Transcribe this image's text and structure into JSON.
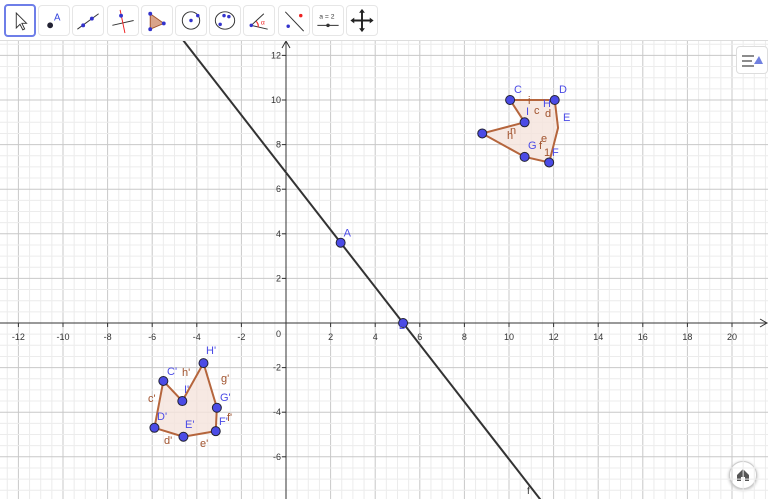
{
  "toolbar": {
    "tools": [
      "Move",
      "Point",
      "Line",
      "Perpendicular Line",
      "Polygon",
      "Circle with Center",
      "Circle through 3 Points",
      "Angle",
      "Reflect about Line",
      "Slider",
      "Move Graphics View"
    ],
    "slider_label": "a = 2",
    "point_label": "A",
    "angle_label": "α"
  },
  "right": {
    "undo": "undo-icon",
    "redo": "redo-icon",
    "search": "search-icon",
    "menu": "menu-icon"
  },
  "axes": {
    "x_ticks": [
      -12,
      -10,
      -8,
      -6,
      -4,
      -2,
      2,
      4,
      6,
      8,
      10,
      12,
      14,
      16,
      18,
      20
    ],
    "y_ticks": [
      12,
      10,
      8,
      6,
      4,
      2,
      -2,
      -4,
      -6
    ],
    "origin_label": "0",
    "xrange": [
      -12.8,
      21.6
    ],
    "yrange": [
      -7.8,
      12.3
    ]
  },
  "line": {
    "name": "f",
    "points": [
      [
        2.45,
        3.6
      ],
      [
        5.25,
        0
      ]
    ]
  },
  "free_points": [
    {
      "name": "A",
      "x": 2.45,
      "y": 3.6
    },
    {
      "name": "B",
      "x": 5.25,
      "y": 0
    }
  ],
  "polygon": {
    "vertices": [
      [
        10.05,
        10
      ],
      [
        12.05,
        10
      ],
      [
        12.2,
        8.75
      ],
      [
        11.8,
        7.2
      ],
      [
        10.7,
        7.45
      ],
      [
        8.8,
        8.5
      ],
      [
        10.7,
        9.0
      ]
    ],
    "labels": [
      "C",
      "D",
      "H",
      "E",
      "F",
      "G",
      "I"
    ],
    "edge_labels": [
      "i",
      "c",
      "d",
      "e",
      "f",
      "1",
      "h",
      "n"
    ]
  },
  "image": {
    "vertices": [
      [
        -5.5,
        -2.6
      ],
      [
        -4.65,
        -3.5
      ],
      [
        -3.7,
        -1.8
      ],
      [
        -3.1,
        -3.8
      ],
      [
        -3.15,
        -4.85
      ],
      [
        -4.6,
        -5.1
      ],
      [
        -5.9,
        -4.7
      ]
    ],
    "labels": [
      "C'",
      "I'",
      "H'",
      "G'",
      "F'",
      "E'",
      "D'"
    ],
    "edge_labels": [
      "h'",
      "g'",
      "c'",
      "f'",
      "d'",
      "e'"
    ]
  },
  "colors": {
    "point": "#4b4be6",
    "poly": "#b5653c",
    "fill": "#f5e4dc",
    "line": "#333333",
    "label": "#4b4be6",
    "edge_label": "#a0522d"
  }
}
